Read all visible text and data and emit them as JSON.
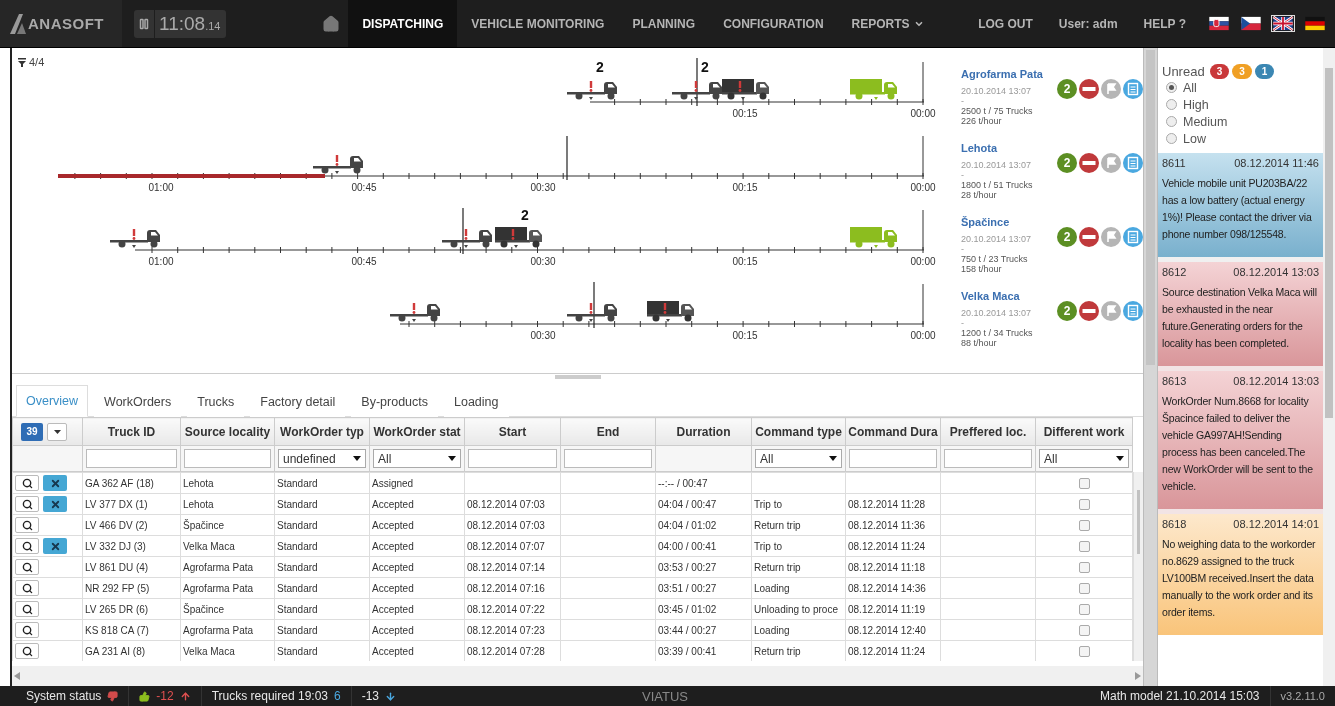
{
  "header": {
    "logo": "ANASOFT",
    "clock": "11:08",
    "clock_fraction": ".14",
    "nav": [
      {
        "label": "DISPATCHING",
        "selected": true,
        "dropdown": false
      },
      {
        "label": "VEHICLE MONITORING",
        "selected": false,
        "dropdown": false
      },
      {
        "label": "PLANNING",
        "selected": false,
        "dropdown": false
      },
      {
        "label": "CONFIGURATION",
        "selected": false,
        "dropdown": false
      },
      {
        "label": "REPORTS",
        "selected": false,
        "dropdown": true
      }
    ],
    "logout": "LOG OUT",
    "user": "User: adm",
    "help": "HELP ?",
    "languages": [
      {
        "kind": "sk",
        "selected": false
      },
      {
        "kind": "cz",
        "selected": false
      },
      {
        "kind": "uk",
        "selected": true
      },
      {
        "kind": "de",
        "selected": false
      }
    ]
  },
  "filter_count": "4/4",
  "timelines": [
    {
      "overdue": false,
      "ticks": [
        "00:15",
        "00:00"
      ],
      "trucks": [
        {
          "kind": "empty",
          "count": "2"
        },
        {
          "kind": "empty",
          "count": "2"
        },
        {
          "kind": "loaded"
        },
        {
          "kind": "done"
        }
      ]
    },
    {
      "overdue": true,
      "ticks": [
        "01:00",
        "00:45",
        "00:30",
        "00:15",
        "00:00"
      ],
      "trucks": [
        {
          "kind": "empty"
        }
      ]
    },
    {
      "overdue": false,
      "ticks": [
        "01:00",
        "00:45",
        "00:30",
        "00:15",
        "00:00"
      ],
      "trucks": [
        {
          "kind": "empty"
        },
        {
          "kind": "empty"
        },
        {
          "kind": "loaded",
          "count": "2"
        },
        {
          "kind": "done"
        }
      ]
    },
    {
      "overdue": false,
      "ticks": [
        "00:30",
        "00:15",
        "00:00"
      ],
      "trucks": [
        {
          "kind": "empty"
        },
        {
          "kind": "empty"
        },
        {
          "kind": "loaded"
        }
      ]
    }
  ],
  "localities": [
    {
      "name": "Agrofarma Pata",
      "date": "20.10.2014 13:07",
      "dash": "-",
      "amount": "2500 t / 75 Trucks",
      "rate": "226 t/hour",
      "badge": "2"
    },
    {
      "name": "Lehota",
      "date": "20.10.2014 13:07",
      "dash": "-",
      "amount": "1800 t / 51 Trucks",
      "rate": "28 t/hour",
      "badge": "2"
    },
    {
      "name": "Špačince",
      "date": "20.10.2014 13:07",
      "dash": "-",
      "amount": "750 t / 23 Trucks",
      "rate": "158 t/hour",
      "badge": "2"
    },
    {
      "name": "Velka Maca",
      "date": "20.10.2014 13:07",
      "dash": "-",
      "amount": "1200 t / 34 Trucks",
      "rate": "88 t/hour",
      "badge": "2"
    }
  ],
  "tabs": [
    {
      "label": "Overview",
      "selected": true
    },
    {
      "label": "WorkOrders",
      "selected": false
    },
    {
      "label": "Trucks",
      "selected": false
    },
    {
      "label": "Factory detail",
      "selected": false
    },
    {
      "label": "By-products",
      "selected": false
    },
    {
      "label": "Loading",
      "selected": false
    }
  ],
  "table": {
    "count": "39",
    "columns": [
      "Truck ID",
      "Source locality",
      "WorkOrder typ",
      "WorkOrder stat",
      "Start",
      "End",
      "Durration",
      "Command type",
      "Command Dura",
      "Preffered loc.",
      "Different work"
    ],
    "filters": [
      {
        "kind": "text"
      },
      {
        "kind": "text"
      },
      {
        "kind": "select",
        "value": "undefined"
      },
      {
        "kind": "select",
        "value": "All"
      },
      {
        "kind": "text"
      },
      {
        "kind": "text"
      },
      {
        "kind": "none"
      },
      {
        "kind": "select",
        "value": "All"
      },
      {
        "kind": "text"
      },
      {
        "kind": "text"
      },
      {
        "kind": "select",
        "value": "All"
      }
    ],
    "rows": [
      {
        "cancel": true,
        "different_work": false,
        "cells": [
          "GA 362 AF (18)",
          "Lehota",
          "Standard",
          "Assigned",
          null,
          null,
          "--:-- / 00:47",
          null,
          null,
          null
        ]
      },
      {
        "cancel": true,
        "different_work": false,
        "cells": [
          "LV 377 DX (1)",
          "Lehota",
          "Standard",
          "Accepted",
          "08.12.2014 07:03",
          null,
          "04:04 / 00:47",
          "Trip to",
          "08.12.2014 11:28",
          null
        ]
      },
      {
        "cancel": false,
        "different_work": false,
        "cells": [
          "LV 466 DV (2)",
          "Špačince",
          "Standard",
          "Accepted",
          "08.12.2014 07:03",
          null,
          "04:04 / 01:02",
          "Return trip",
          "08.12.2014 11:36",
          null
        ]
      },
      {
        "cancel": true,
        "different_work": false,
        "cells": [
          "LV 332 DJ (3)",
          "Velka Maca",
          "Standard",
          "Accepted",
          "08.12.2014 07:07",
          null,
          "04:00 / 00:41",
          "Trip to",
          "08.12.2014 11:24",
          null
        ]
      },
      {
        "cancel": false,
        "different_work": false,
        "cells": [
          "LV 861 DU (4)",
          "Agrofarma Pata",
          "Standard",
          "Accepted",
          "08.12.2014 07:14",
          null,
          "03:53 / 00:27",
          "Return trip",
          "08.12.2014 11:18",
          null
        ]
      },
      {
        "cancel": false,
        "different_work": false,
        "cells": [
          "NR 292 FP (5)",
          "Agrofarma Pata",
          "Standard",
          "Accepted",
          "08.12.2014 07:16",
          null,
          "03:51 / 00:27",
          "Loading",
          "08.12.2014 14:36",
          null
        ]
      },
      {
        "cancel": false,
        "different_work": false,
        "cells": [
          "LV 265 DR (6)",
          "Špačince",
          "Standard",
          "Accepted",
          "08.12.2014 07:22",
          null,
          "03:45 / 01:02",
          "Unloading to proce",
          "08.12.2014 11:19",
          null
        ]
      },
      {
        "cancel": false,
        "different_work": false,
        "cells": [
          "KS 818 CA (7)",
          "Agrofarma Pata",
          "Standard",
          "Accepted",
          "08.12.2014 07:23",
          null,
          "03:44 / 00:27",
          "Loading",
          "08.12.2014 12:40",
          null
        ]
      },
      {
        "cancel": false,
        "different_work": false,
        "cells": [
          "GA 231 AI (8)",
          "Velka Maca",
          "Standard",
          "Accepted",
          "08.12.2014 07:28",
          null,
          "03:39 / 00:41",
          "Return trip",
          "08.12.2014 11:24",
          null
        ]
      }
    ]
  },
  "notifications": {
    "title": "Unread",
    "unread": [
      {
        "kind": "high",
        "count": "3"
      },
      {
        "kind": "medium",
        "count": "3"
      },
      {
        "kind": "low",
        "count": "1"
      }
    ],
    "filters": [
      {
        "label": "All",
        "selected": true
      },
      {
        "label": "High",
        "selected": false
      },
      {
        "label": "Medium",
        "selected": false
      },
      {
        "label": "Low",
        "selected": false
      }
    ],
    "messages": [
      {
        "kind": "low",
        "id": "8611",
        "date": "08.12.2014 11:46",
        "text": "Vehicle mobile unit PU203BA/22 has a low battery (actual energy 1%)! Please contact the driver via phone number 098/125548."
      },
      {
        "kind": "high",
        "id": "8612",
        "date": "08.12.2014 13:03",
        "text": "Source destination Velka Maca will be exhausted in the near future.Generating orders for the locality has been completed."
      },
      {
        "kind": "high",
        "id": "8613",
        "date": "08.12.2014 13:03",
        "text": "WorkOrder Num.8668 for locality Špacince failed to deliver the vehicle GA997AH!Sending process has been canceled.The new WorkOrder will be sent to the vehicle."
      },
      {
        "kind": "medium",
        "id": "8618",
        "date": "08.12.2014 14:01",
        "text": "No weighing data to the workorder no.8629 assigned to the truck LV100BM received.Insert the data manually to the work order and its order items."
      }
    ]
  },
  "status_bar": {
    "system_status": "System status",
    "delta_up": "-12",
    "trucks_required": "Trucks required 19:03",
    "required_count": "6",
    "delta_down": "-13",
    "brand": "VIATUS",
    "math_model": "Math model 21.10.2014 15:03",
    "version": "v3.2.11.0"
  }
}
